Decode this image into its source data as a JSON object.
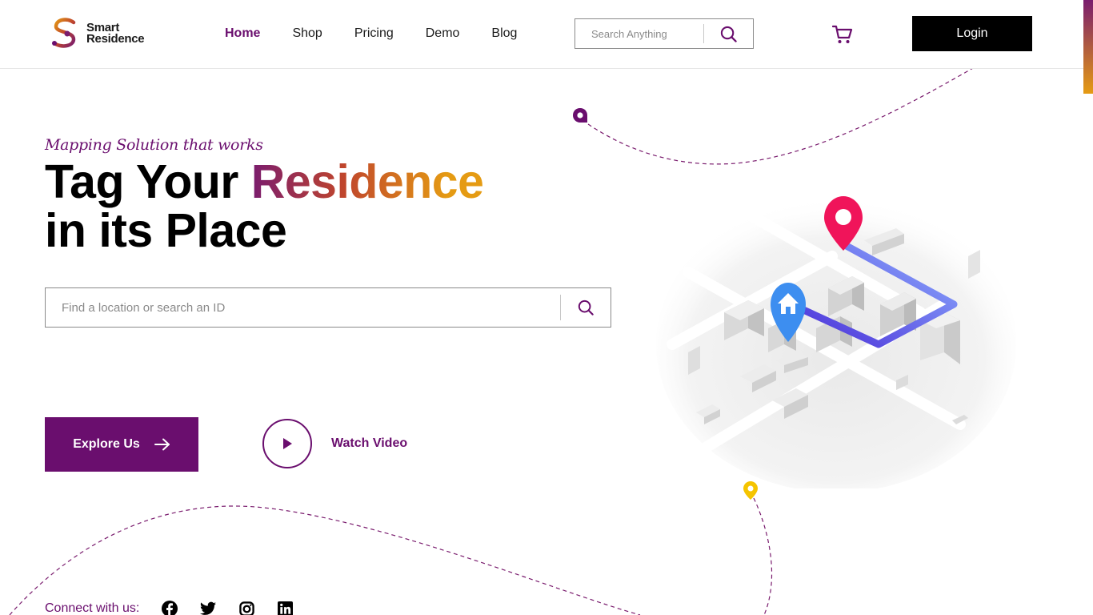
{
  "brand": {
    "line1": "Smart",
    "line2": "Residence"
  },
  "nav": [
    {
      "label": "Home",
      "active": true
    },
    {
      "label": "Shop",
      "active": false
    },
    {
      "label": "Pricing",
      "active": false
    },
    {
      "label": "Demo",
      "active": false
    },
    {
      "label": "Blog",
      "active": false
    }
  ],
  "header_search": {
    "placeholder": "Search Anything"
  },
  "login_label": "Login",
  "hero": {
    "tagline": "Mapping Solution that works",
    "headline_part1": "Tag Your ",
    "headline_highlight": "Residence",
    "headline_line2": "in its Place",
    "search_placeholder": "Find a location or search an ID",
    "explore_label": "Explore Us",
    "watch_label": "Watch Video"
  },
  "connect_label": "Connect with us:",
  "socials": [
    "facebook-icon",
    "twitter-icon",
    "instagram-icon",
    "linkedin-icon"
  ],
  "colors": {
    "brand": "#6a0e6e",
    "gradient_start": "#7a1c6e",
    "gradient_end": "#e59b13",
    "pin_red": "#f0145a",
    "pin_blue": "#3d8ef0",
    "pin_yellow": "#f5c400"
  }
}
